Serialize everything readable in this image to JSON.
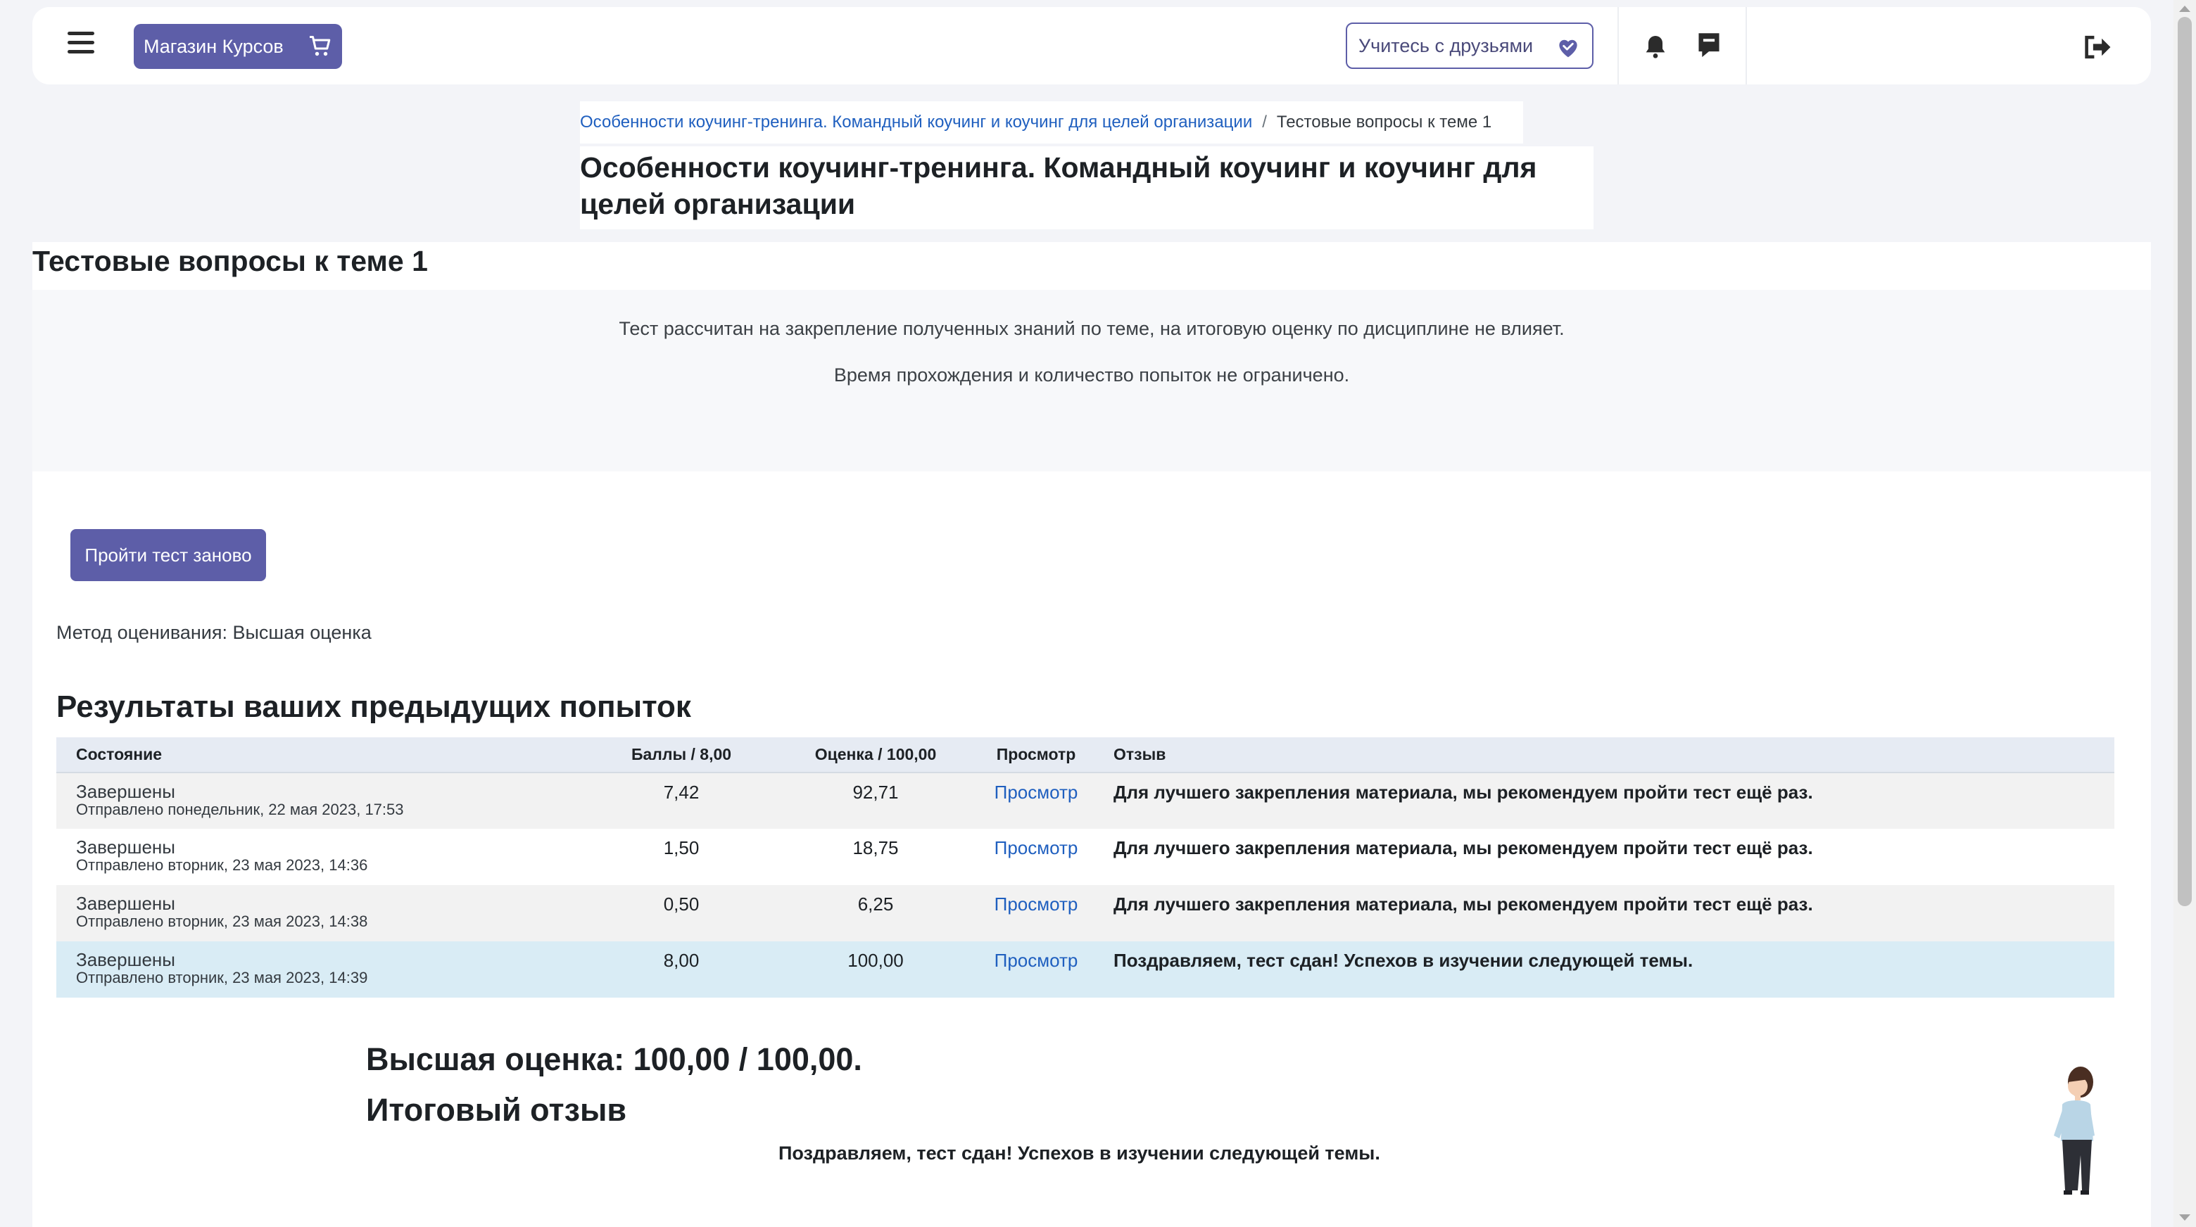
{
  "topbar": {
    "shop_label": "Магазин Курсов",
    "friends_label": "Учитесь с друзьями"
  },
  "breadcrumb": {
    "course_link": "Особенности коучинг-тренинга. Командный коучинг и коучинг для целей организации",
    "separator": "/",
    "current": "Тестовые вопросы к теме 1"
  },
  "course_title": "Особенности коучинг-тренинга. Командный коучинг и коучинг для целей организации",
  "page_heading": "Тестовые вопросы к теме 1",
  "intro": {
    "line1": "Тест рассчитан на закрепление полученных знаний по теме, на итоговую оценку по дисциплине не влияет.",
    "line2": "Время прохождения и количество попыток не ограничено."
  },
  "retry_label": "Пройти тест заново",
  "grading_method": "Метод оценивания: Высшая оценка",
  "results": {
    "heading": "Результаты ваших предыдущих попыток",
    "columns": [
      "Состояние",
      "Баллы / 8,00",
      "Оценка / 100,00",
      "Просмотр",
      "Отзыв"
    ],
    "rows": [
      {
        "state": "Завершены",
        "sent": "Отправлено понедельник, 22 мая 2023, 17:53",
        "points": "7,42",
        "grade": "92,71",
        "view": "Просмотр",
        "feedback": "Для лучшего закрепления материала, мы рекомендуем пройти тест ещё раз."
      },
      {
        "state": "Завершены",
        "sent": "Отправлено вторник, 23 мая 2023, 14:36",
        "points": "1,50",
        "grade": "18,75",
        "view": "Просмотр",
        "feedback": "Для лучшего закрепления материала, мы рекомендуем пройти тест ещё раз."
      },
      {
        "state": "Завершены",
        "sent": "Отправлено вторник, 23 мая 2023, 14:38",
        "points": "0,50",
        "grade": "6,25",
        "view": "Просмотр",
        "feedback": "Для лучшего закрепления материала, мы рекомендуем пройти тест ещё раз."
      },
      {
        "state": "Завершены",
        "sent": "Отправлено вторник, 23 мая 2023, 14:39",
        "points": "8,00",
        "grade": "100,00",
        "view": "Просмотр",
        "feedback": "Поздравляем, тест сдан! Успехов в изучении следующей темы."
      }
    ]
  },
  "best_grade": "Высшая оценка: 100,00 / 100,00.",
  "final_feedback_heading": "Итоговый отзыв",
  "final_feedback": "Поздравляем, тест сдан! Успехов в изучении следующей темы.",
  "colors": {
    "accent": "#5d5ea8",
    "link": "#1f5fbf",
    "best_row": "#d9ecf5"
  }
}
